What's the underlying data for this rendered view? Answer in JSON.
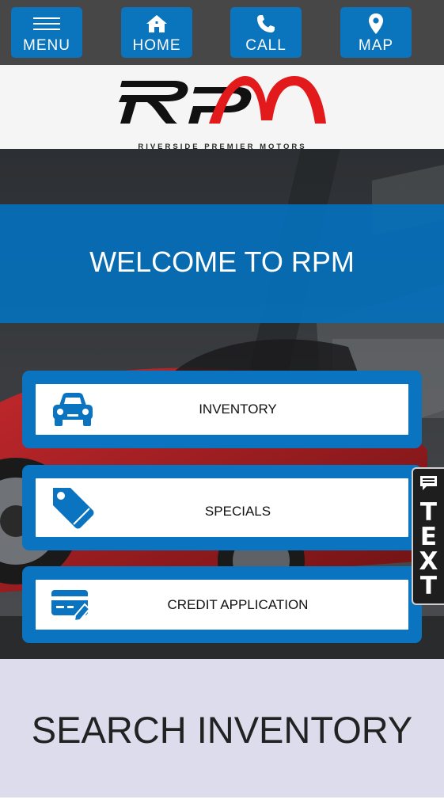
{
  "nav": {
    "menu_label": "MENU",
    "home_label": "HOME",
    "call_label": "CALL",
    "map_label": "MAP"
  },
  "logo": {
    "name": "RPM",
    "tagline": "RIVERSIDE PREMIER MOTORS",
    "colors": {
      "dark": "#111111",
      "accent": "#e31a1c"
    }
  },
  "hero": {
    "welcome_title": "WELCOME TO RPM"
  },
  "quick_links": [
    {
      "label": "INVENTORY",
      "icon": "car-icon"
    },
    {
      "label": "SPECIALS",
      "icon": "price-tag-icon"
    },
    {
      "label": "CREDIT APPLICATION",
      "icon": "credit-card-icon"
    }
  ],
  "text_widget": {
    "letters": [
      "T",
      "E",
      "X",
      "T"
    ],
    "icon": "chat-bubble-icon"
  },
  "search": {
    "title": "SEARCH INVENTORY"
  },
  "colors": {
    "nav_bg": "#474747",
    "brand_blue": "#0a74bd",
    "search_bg": "#dcdcec"
  }
}
